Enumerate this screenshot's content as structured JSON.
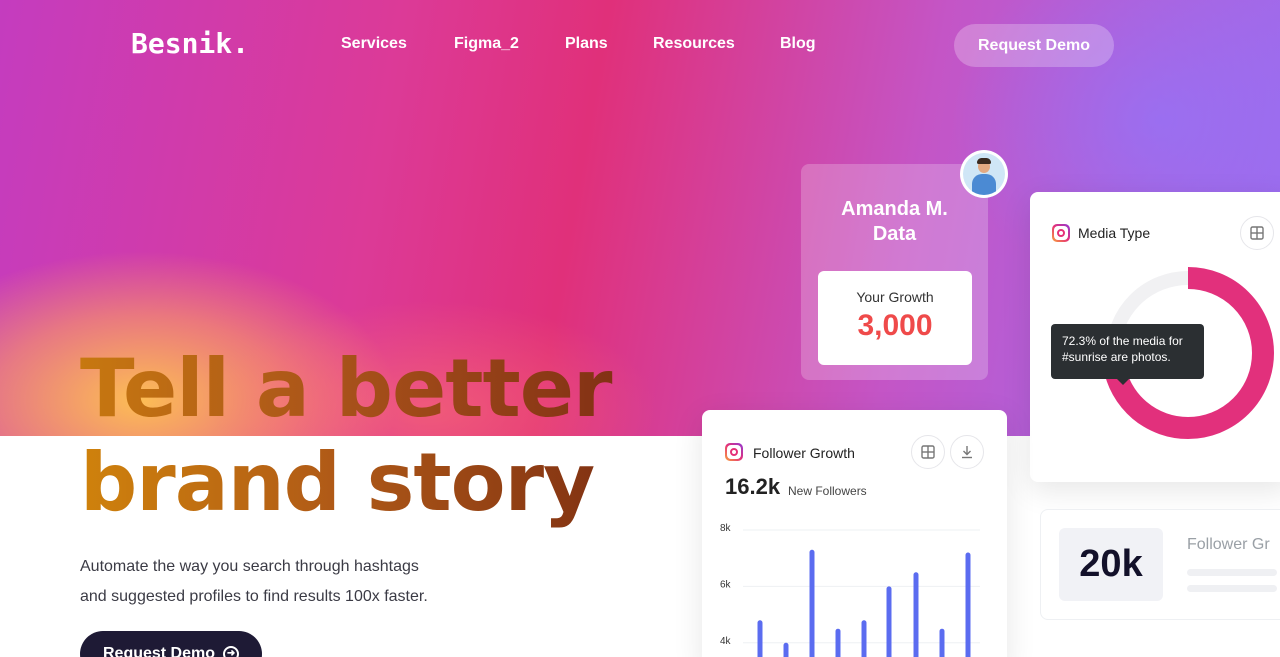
{
  "brand": {
    "logo": "Besnik."
  },
  "nav": {
    "items": [
      {
        "label": "Services"
      },
      {
        "label": "Figma_2"
      },
      {
        "label": "Plans"
      },
      {
        "label": "Resources"
      },
      {
        "label": "Blog"
      }
    ],
    "cta_label": "Request Demo"
  },
  "hero": {
    "headline_line1": "Tell a better",
    "headline_line2": "brand story",
    "subtext_line1": "Automate the way you search through hashtags",
    "subtext_line2": "and suggested profiles to find results 100x faster.",
    "cta_label": "Request Demo"
  },
  "profile_card": {
    "name_line1": "Amanda M.",
    "name_line2": "Data",
    "growth_label": "Your Growth",
    "growth_value": "3,000"
  },
  "media_card": {
    "title": "Media Type",
    "tooltip_line1": "72.3% of the media for",
    "tooltip_line2": "#sunrise are photos.",
    "photo_share": 0.723,
    "colors": {
      "photos": "#e2307c",
      "other": "#f1f1f3"
    }
  },
  "follower_card": {
    "title": "Follower Growth",
    "value": "16.2k",
    "value_label": "New Followers",
    "chart_data": {
      "type": "bar",
      "yticks": [
        "8k",
        "6k",
        "4k"
      ],
      "ylim": [
        0,
        8000
      ],
      "values": [
        4800,
        4000,
        7300,
        4500,
        4800,
        6000,
        6500,
        4500,
        7200
      ],
      "bar_color": "#5b6cf0",
      "grid": true
    }
  },
  "stat_card": {
    "value": "20k",
    "title": "Follower Gr"
  },
  "colors": {
    "accent": "#1e1a35",
    "growth_red": "#ef4a4a"
  }
}
